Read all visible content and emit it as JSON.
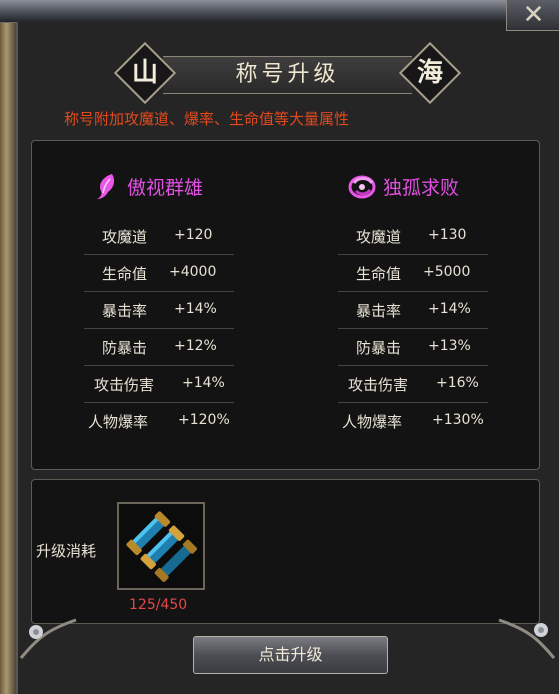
{
  "header": {
    "title": "称号升级",
    "left_emblem": "山",
    "right_emblem": "海",
    "close_glyph": "✕"
  },
  "description": "称号附加攻魔道、爆率、生命值等大量属性",
  "titles": [
    {
      "name": "傲视群雄",
      "icon": "feather-icon",
      "stats": [
        {
          "label": "攻魔道",
          "value": "+120"
        },
        {
          "label": "生命值",
          "value": "+4000"
        },
        {
          "label": "暴击率",
          "value": "+14%"
        },
        {
          "label": "防暴击",
          "value": "+12%"
        },
        {
          "label": "攻击伤害",
          "value": "+14%"
        },
        {
          "label": "人物爆率",
          "value": "+120%"
        }
      ]
    },
    {
      "name": "独孤求败",
      "icon": "swirl-emblem-icon",
      "stats": [
        {
          "label": "攻魔道",
          "value": "+130"
        },
        {
          "label": "生命值",
          "value": "+5000"
        },
        {
          "label": "暴击率",
          "value": "+14%"
        },
        {
          "label": "防暴击",
          "value": "+13%"
        },
        {
          "label": "攻击伤害",
          "value": "+16%"
        },
        {
          "label": "人物爆率",
          "value": "+130%"
        }
      ]
    }
  ],
  "cost": {
    "label": "升级消耗",
    "item_icon": "scroll-icon",
    "count": "125/450"
  },
  "upgrade_button": "点击升级",
  "colors": {
    "description": "#e2491d",
    "title_name": "#df4fe0",
    "count": "#e3494b"
  }
}
